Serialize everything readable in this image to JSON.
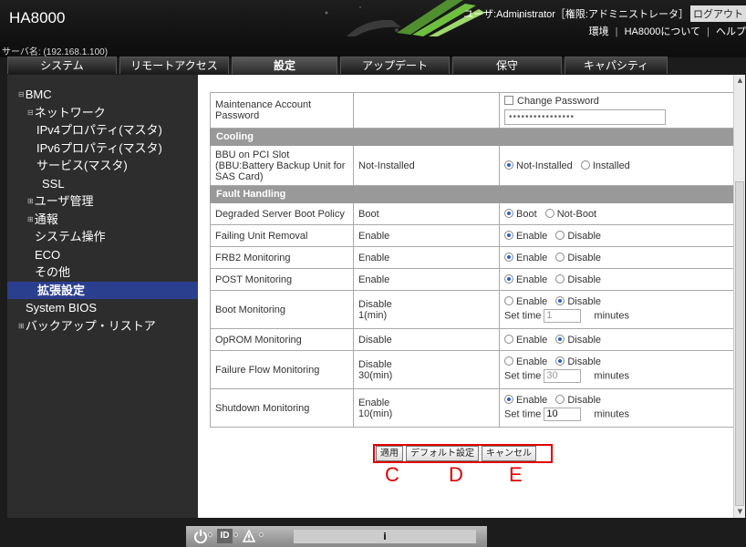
{
  "header": {
    "title": "HA8000",
    "server": "サーバ名: (192.168.1.100)",
    "user": "ユーザ:Administrator［権限:アドミニストレータ］",
    "logout": "ログアウト",
    "links": [
      "環境",
      "HA8000について",
      "ヘルプ"
    ]
  },
  "tabs": [
    "システム",
    "リモートアクセス",
    "設定",
    "アップデート",
    "保守",
    "キャパシティ"
  ],
  "sidebar": {
    "items": [
      {
        "label": "BMC",
        "exp": "⊟"
      },
      {
        "label": "ネットワーク",
        "exp": "⊟"
      },
      {
        "label": "IPv4プロパティ(マスタ)"
      },
      {
        "label": "IPv6プロパティ(マスタ)"
      },
      {
        "label": "サービス(マスタ)"
      },
      {
        "label": "SSL"
      },
      {
        "label": "ユーザ管理",
        "exp": "⊞"
      },
      {
        "label": "通報",
        "exp": "⊞"
      },
      {
        "label": "システム操作"
      },
      {
        "label": "ECO"
      },
      {
        "label": "その他"
      },
      {
        "label": "拡張設定"
      },
      {
        "label": "System BIOS"
      },
      {
        "label": "バックアップ・リストア",
        "exp": "⊞"
      }
    ]
  },
  "table": {
    "maintenance": {
      "label": "Maintenance Account Password",
      "value": "",
      "change_label": "Change Password",
      "password": "••••••••••••••••"
    },
    "cooling_header": "Cooling",
    "bbu": {
      "label": "BBU on PCI Slot (BBU:Battery Backup Unit for SAS Card)",
      "value": "Not-Installed",
      "opt1": "Not-Installed",
      "opt2": "Installed"
    },
    "fault_header": "Fault Handling",
    "degraded": {
      "label": "Degraded Server Boot Policy",
      "value": "Boot",
      "opt1": "Boot",
      "opt2": "Not-Boot"
    },
    "failing": {
      "label": "Failing Unit Removal",
      "value": "Enable",
      "opt1": "Enable",
      "opt2": "Disable"
    },
    "frb2": {
      "label": "FRB2 Monitoring",
      "value": "Enable",
      "opt1": "Enable",
      "opt2": "Disable"
    },
    "post": {
      "label": "POST Monitoring",
      "value": "Enable",
      "opt1": "Enable",
      "opt2": "Disable"
    },
    "bootmon": {
      "label": "Boot Monitoring",
      "value1": "Disable",
      "value2": "1(min)",
      "opt1": "Enable",
      "opt2": "Disable",
      "settime": "Set time",
      "time": "1",
      "minutes": "minutes"
    },
    "oprom": {
      "label": "OpROM Monitoring",
      "value": "Disable",
      "opt1": "Enable",
      "opt2": "Disable"
    },
    "failure": {
      "label": "Failure Flow Monitoring",
      "value1": "Disable",
      "value2": "30(min)",
      "opt1": "Enable",
      "opt2": "Disable",
      "settime": "Set time",
      "time": "30",
      "minutes": "minutes"
    },
    "shutdown": {
      "label": "Shutdown Monitoring",
      "value1": "Enable",
      "value2": "10(min)",
      "opt1": "Enable",
      "opt2": "Disable",
      "settime": "Set time",
      "time": "10",
      "minutes": "minutes"
    }
  },
  "buttons": {
    "apply": "適用",
    "default": "デフォルト設定",
    "cancel": "キャンセル"
  },
  "annotations": {
    "c": "C",
    "d": "D",
    "e": "E"
  },
  "footer": {
    "id": "ID",
    "info": "i"
  }
}
